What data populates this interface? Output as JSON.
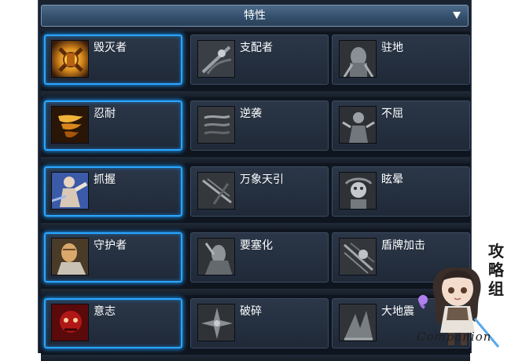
{
  "header": {
    "title": "特性",
    "dropdown_icon": "triangle-down-icon"
  },
  "rows": [
    {
      "cards": [
        {
          "label": "毁灭者",
          "icon": "destroyer-icon",
          "selected": true
        },
        {
          "label": "支配者",
          "icon": "dominator-icon",
          "selected": false
        },
        {
          "label": "驻地",
          "icon": "garrison-icon",
          "selected": false
        }
      ]
    },
    {
      "cards": [
        {
          "label": "忍耐",
          "icon": "endurance-icon",
          "selected": true
        },
        {
          "label": "逆袭",
          "icon": "counterattack-icon",
          "selected": false
        },
        {
          "label": "不屈",
          "icon": "unyielding-icon",
          "selected": false
        }
      ]
    },
    {
      "cards": [
        {
          "label": "抓握",
          "icon": "grip-icon",
          "selected": true
        },
        {
          "label": "万象天引",
          "icon": "pull-icon",
          "selected": false
        },
        {
          "label": "眩晕",
          "icon": "stun-icon",
          "selected": false
        }
      ]
    },
    {
      "cards": [
        {
          "label": "守护者",
          "icon": "guardian-icon",
          "selected": true
        },
        {
          "label": "要塞化",
          "icon": "fortify-icon",
          "selected": false
        },
        {
          "label": "盾牌加击",
          "icon": "shield-bash-icon",
          "selected": false
        }
      ]
    },
    {
      "cards": [
        {
          "label": "意志",
          "icon": "will-icon",
          "selected": true
        },
        {
          "label": "破碎",
          "icon": "shatter-icon",
          "selected": false
        },
        {
          "label": "大地震",
          "icon": "earthquake-icon",
          "selected": false
        }
      ]
    }
  ],
  "watermark": {
    "title": "攻略组",
    "caption": "Companion",
    "icon": "chibi-mascot-icon"
  },
  "colors": {
    "selected_border": "#2aa6ff",
    "header_bg": "#34506d",
    "card_bg": "#2b3748"
  }
}
